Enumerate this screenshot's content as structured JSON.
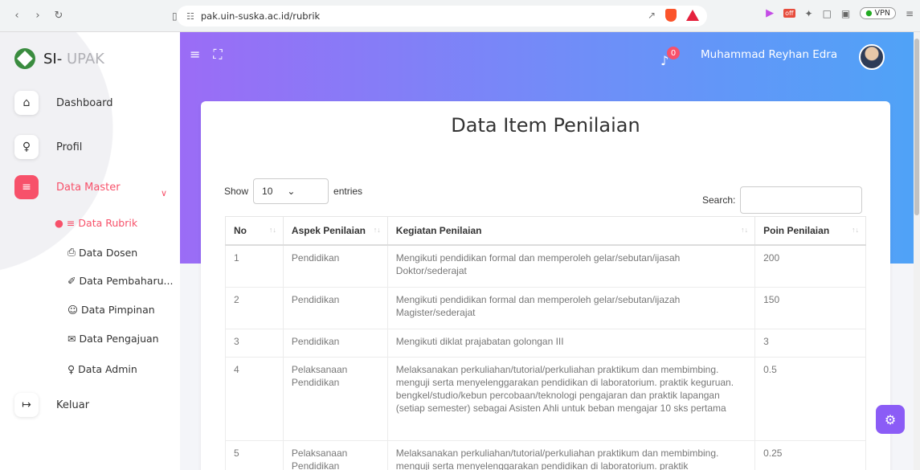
{
  "browser": {
    "url": "pak.uin-suska.ac.id/rubrik",
    "vpn_label": "VPN",
    "off_badge": "off"
  },
  "sidebar": {
    "logo_primary": "SI-",
    "logo_secondary": "UPAK",
    "items": [
      {
        "label": "Dashboard"
      },
      {
        "label": "Profil"
      },
      {
        "label": "Data Master"
      },
      {
        "label": "Keluar"
      }
    ],
    "subitems": [
      {
        "label": "Data Rubrik"
      },
      {
        "label": "Data Dosen"
      },
      {
        "label": "Data Pembaharu..."
      },
      {
        "label": "Data Pimpinan"
      },
      {
        "label": "Data Pengajuan"
      },
      {
        "label": "Data Admin"
      }
    ]
  },
  "header": {
    "notification_count": "0",
    "user_name": "Muhammad Reyhan Edra"
  },
  "main": {
    "title": "Data Item Penilaian",
    "show_label": "Show",
    "entries_value": "10",
    "entries_label": "entries",
    "search_label": "Search:",
    "columns": [
      "No",
      "Aspek Penilaian",
      "Kegiatan Penilaian",
      "Poin Penilaian"
    ],
    "rows": [
      {
        "no": "1",
        "aspek": "Pendidikan",
        "kegiatan": "Mengikuti pendidikan formal dan memperoleh gelar/sebutan/ijasah Doktor/sederajat",
        "poin": "200"
      },
      {
        "no": "2",
        "aspek": "Pendidikan",
        "kegiatan": "Mengikuti pendidikan formal dan memperoleh gelar/sebutan/ijazah Magister/sederajat",
        "poin": "150"
      },
      {
        "no": "3",
        "aspek": "Pendidikan",
        "kegiatan": "Mengikuti diklat prajabatan golongan III",
        "poin": "3"
      },
      {
        "no": "4",
        "aspek": "Pelaksanaan Pendidikan",
        "kegiatan": "Melaksanakan perkuliahan/tutorial/perkuliahan praktikum dan membimbing. menguji serta menyelenggarakan pendidikan di laboratorium. praktik keguruan. bengkel/studio/kebun percobaan/teknologi pengajaran dan praktik lapangan (setiap semester) sebagai Asisten Ahli untuk beban mengajar 10 sks pertama",
        "poin": "0.5"
      },
      {
        "no": "5",
        "aspek": "Pelaksanaan Pendidikan",
        "kegiatan": "Melaksanakan perkuliahan/tutorial/perkuliahan praktikum dan membimbing. menguji serta menyelenggarakan pendidikan di laboratorium. praktik",
        "poin": "0.25"
      }
    ]
  }
}
